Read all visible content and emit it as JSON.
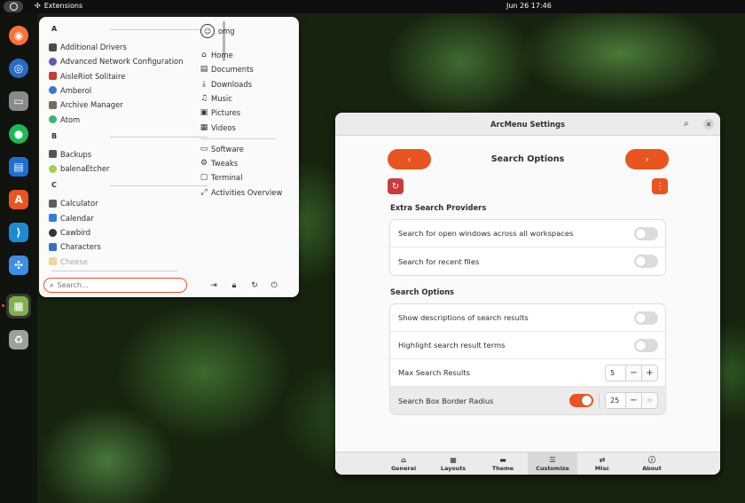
{
  "topbar": {
    "extensions_label": "Extensions",
    "clock": "Jun 26  17:46"
  },
  "dock": {
    "apps": [
      {
        "name": "firefox-icon",
        "color": "#ff7139"
      },
      {
        "name": "thunderbird-icon",
        "color": "#2a6bc7"
      },
      {
        "name": "files-icon",
        "color": "#8a8a8a"
      },
      {
        "name": "spotify-icon",
        "color": "#1db954"
      },
      {
        "name": "writer-icon",
        "color": "#1f6fd0"
      },
      {
        "name": "app-center-icon",
        "color": "#e95420"
      },
      {
        "name": "vscode-icon",
        "color": "#1e8ad6"
      },
      {
        "name": "extensions-icon",
        "color": "#3f8ee6"
      },
      {
        "name": "show-apps-icon",
        "color": "#7fb24b"
      },
      {
        "name": "trash-icon",
        "color": "#9aa39a"
      }
    ]
  },
  "menu": {
    "sections": [
      {
        "letter": "A",
        "apps": [
          {
            "label": "Additional Drivers",
            "color": "#4a4a4a"
          },
          {
            "label": "Advanced Network Configuration",
            "color": "#6a54b0"
          },
          {
            "label": "AisleRiot Solitaire",
            "color": "#c63a3a"
          },
          {
            "label": "Amberol",
            "color": "#3a77d8"
          },
          {
            "label": "Archive Manager",
            "color": "#7a6a5a"
          },
          {
            "label": "Atom",
            "color": "#3fb07a"
          }
        ]
      },
      {
        "letter": "B",
        "apps": [
          {
            "label": "Backups",
            "color": "#555555"
          },
          {
            "label": "balenaEtcher",
            "color": "#a3d24a"
          }
        ]
      },
      {
        "letter": "C",
        "apps": [
          {
            "label": "Calculator",
            "color": "#5b5b5b"
          },
          {
            "label": "Calendar",
            "color": "#3a7bd5"
          },
          {
            "label": "Cawbird",
            "color": "#333333"
          },
          {
            "label": "Characters",
            "color": "#3a6ec9"
          },
          {
            "label": "Cheese",
            "color": "#e3b23c"
          }
        ]
      }
    ],
    "user": "omg",
    "places": [
      {
        "label": "Home",
        "icon": "⌂"
      },
      {
        "label": "Documents",
        "icon": "▤"
      },
      {
        "label": "Downloads",
        "icon": "⤓"
      },
      {
        "label": "Music",
        "icon": "♫"
      },
      {
        "label": "Pictures",
        "icon": "▣"
      },
      {
        "label": "Videos",
        "icon": "▦"
      }
    ],
    "system": [
      {
        "label": "Software",
        "icon": "▭"
      },
      {
        "label": "Tweaks",
        "icon": "⚙"
      },
      {
        "label": "Terminal",
        "icon": "▢"
      },
      {
        "label": "Activities Overview",
        "icon": "⤢"
      }
    ],
    "search_placeholder": "Search…"
  },
  "settings": {
    "window_title": "ArcMenu Settings",
    "page_title": "Search Options",
    "prev_glyph": "‹",
    "next_glyph": "›",
    "sections": [
      {
        "title": "Extra Search Providers",
        "rows": [
          {
            "label": "Search for open windows across all workspaces",
            "type": "switch",
            "on": false
          },
          {
            "label": "Search for recent files",
            "type": "switch",
            "on": false
          }
        ]
      },
      {
        "title": "Search Options",
        "rows": [
          {
            "label": "Show descriptions of search results",
            "type": "switch",
            "on": false
          },
          {
            "label": "Highlight search result terms",
            "type": "switch",
            "on": false
          },
          {
            "label": "Max Search Results",
            "type": "spin",
            "value": "5"
          },
          {
            "label": "Search Box Border Radius",
            "type": "switch-spin",
            "on": true,
            "value": "25"
          }
        ]
      }
    ],
    "tabs": [
      {
        "label": "General",
        "icon": "⌂",
        "selected": false
      },
      {
        "label": "Layouts",
        "icon": "▦",
        "selected": false
      },
      {
        "label": "Theme",
        "icon": "▬",
        "selected": false
      },
      {
        "label": "Customize",
        "icon": "☰",
        "selected": true
      },
      {
        "label": "Misc",
        "icon": "⇄",
        "selected": false
      },
      {
        "label": "About",
        "icon": "ⓘ",
        "selected": false
      }
    ],
    "accent_color": "#e95420",
    "reset_color": "#c93c3c"
  }
}
